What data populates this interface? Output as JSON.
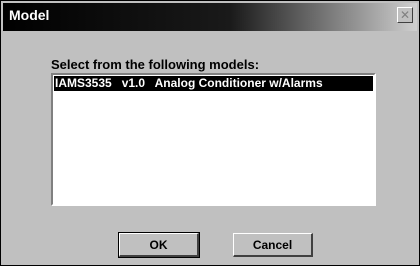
{
  "window": {
    "title": "Model",
    "close_icon": "close-icon"
  },
  "dialog": {
    "prompt": "Select from the following models:",
    "models": [
      "IAMS3535   v1.0   Analog Conditioner w/Alarms"
    ],
    "selected_index": 0
  },
  "buttons": {
    "ok_label": "OK",
    "cancel_label": "Cancel"
  },
  "colors": {
    "window_face": "#c0c0c0",
    "titlebar_start": "#000000",
    "titlebar_end": "#cfcfcf",
    "selection_bg": "#000000",
    "selection_text": "#ffffff"
  }
}
